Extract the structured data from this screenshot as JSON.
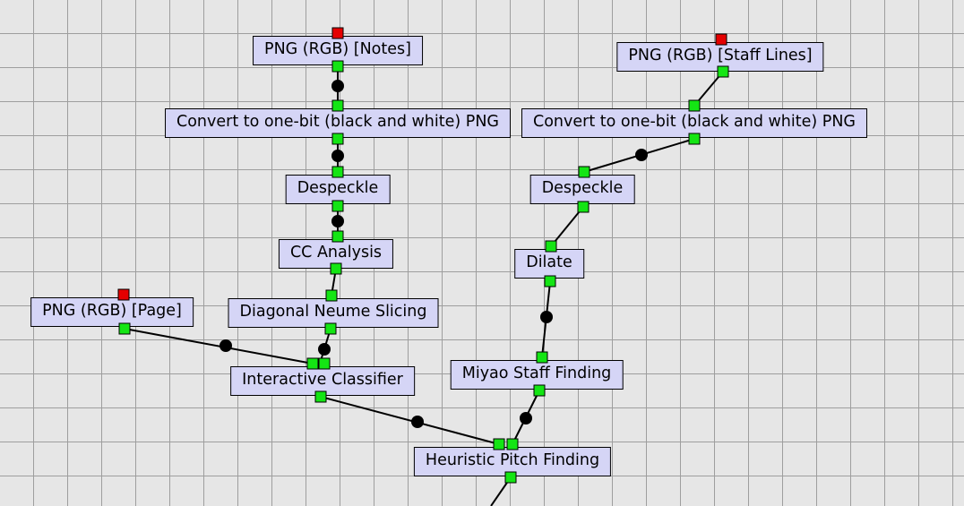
{
  "grid_spacing": 38,
  "canvas_bg": "#e6e6e6",
  "grid_line": "#9e9e9e",
  "node_bg": "#d5d5f6",
  "port_green": "#14e514",
  "port_red": "#e50000",
  "nodes": {
    "png_notes": {
      "label": "PNG (RGB) [Notes]"
    },
    "png_staff": {
      "label": "PNG (RGB) [Staff Lines]"
    },
    "png_page": {
      "label": "PNG (RGB) [Page]"
    },
    "conv1bit_left": {
      "label": "Convert to one-bit (black and white) PNG"
    },
    "conv1bit_right": {
      "label": "Convert to one-bit (black and white) PNG"
    },
    "despeckle_left": {
      "label": "Despeckle"
    },
    "despeckle_right": {
      "label": "Despeckle"
    },
    "cc_analysis": {
      "label": "CC Analysis"
    },
    "dilate": {
      "label": "Dilate"
    },
    "diag_slice": {
      "label": "Diagonal Neume Slicing"
    },
    "miyao": {
      "label": "Miyao Staff Finding"
    },
    "iclassifier": {
      "label": "Interactive Classifier"
    },
    "hpf": {
      "label": "Heuristic Pitch Finding"
    }
  }
}
